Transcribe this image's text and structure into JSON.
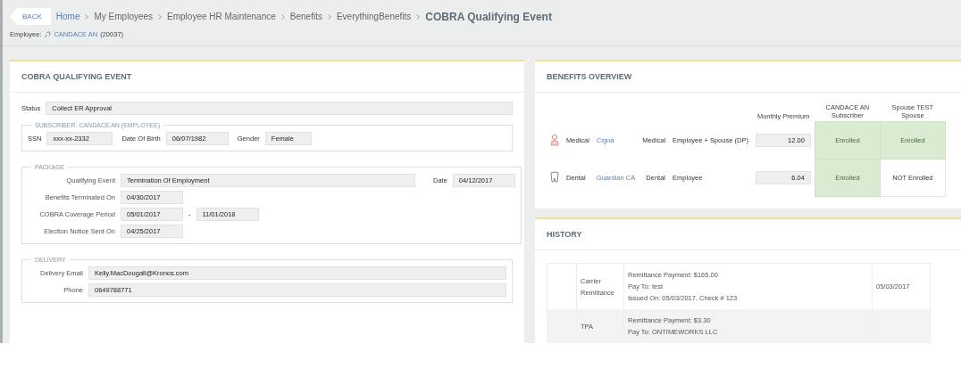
{
  "header": {
    "back_button": "BACK",
    "breadcrumbs": [
      {
        "label": "Home",
        "kind": "link"
      },
      {
        "label": "My Employees",
        "kind": "crumb"
      },
      {
        "label": "Employee HR Maintenance",
        "kind": "crumb"
      },
      {
        "label": "Benefits",
        "kind": "crumb"
      },
      {
        "label": "EverythingBenefits",
        "kind": "crumb"
      },
      {
        "label": "COBRA Qualifying Event",
        "kind": "current"
      }
    ],
    "employee_label": "Employee:",
    "employee_name": "CANDACE AN",
    "employee_id": "(20037)"
  },
  "cobra": {
    "title": "COBRA QUALIFYING EVENT",
    "status_label": "Status",
    "status": "Collect ER Approval",
    "subscriber": {
      "legend": "SUBSCRIBER: CANDACE AN (EMPLOYEE)",
      "ssn_label": "SSN",
      "ssn": "xxx-xx-2332",
      "dob_label": "Date Of Birth",
      "dob": "06/07/1982",
      "gender_label": "Gender",
      "gender": "Female"
    },
    "package": {
      "legend": "PACKAGE",
      "event_label": "Qualifying Event",
      "event": "Termination Of Employment",
      "date_label": "Date",
      "date": "04/12/2017",
      "terminated_label": "Benefits Terminated On",
      "terminated": "04/30/2017",
      "coverage_label": "COBRA Coverage Period",
      "coverage_start": "05/01/2017",
      "coverage_sep": "-",
      "coverage_end": "11/01/2018",
      "notice_label": "Election Notice Sent On",
      "notice": "04/25/2017"
    },
    "delivery": {
      "legend": "DELIVERY",
      "email_label": "Delivery Email",
      "email": "Kelly.MacDougall@Kronos.com",
      "phone_label": "Phone",
      "phone": "0649788771"
    }
  },
  "benefits_overview": {
    "title": "BENEFITS OVERVIEW",
    "columns": [
      {
        "line1": "Monthly Premium"
      },
      {
        "line1": "CANDACE AN",
        "line2": "Subscriber"
      },
      {
        "line1": "Spouse TEST",
        "line2": "Spouse"
      }
    ],
    "rows": [
      {
        "kind": "medical",
        "type": "Medical",
        "carrier": "Cigna",
        "plan": "Medical",
        "coverage": "Employee + Spouse (DP)",
        "premium": "12.00",
        "subscriber": {
          "status": "Enrolled",
          "enrolled": true
        },
        "spouse": {
          "status": "Enrolled",
          "enrolled": true
        }
      },
      {
        "kind": "dental",
        "type": "Dental",
        "carrier": "Guardian CA",
        "plan": "Dental",
        "coverage": "Employee",
        "premium": "6.04",
        "subscriber": {
          "status": "Enrolled",
          "enrolled": true
        },
        "spouse": {
          "status": "NOT Enrolled",
          "enrolled": false
        }
      }
    ]
  },
  "history": {
    "title": "HISTORY",
    "rows": [
      {
        "type": [
          "Carrier",
          "Remittance"
        ],
        "lines": [
          "Remittance Payment: $165.00",
          "Pay To: test",
          "Issued On: 05/03/2017, Check # 123"
        ],
        "date": "05/03/2017"
      },
      {
        "type": [
          "TPA"
        ],
        "lines": [
          "Remittance Payment: $3.30",
          "Pay To: ONTIMEWORKS LLC"
        ]
      }
    ]
  }
}
